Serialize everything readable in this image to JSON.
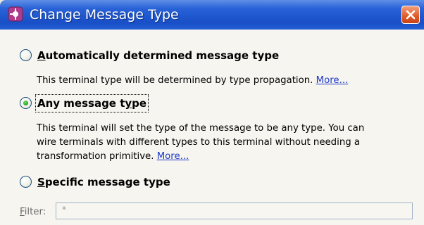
{
  "window": {
    "title": "Change Message Type",
    "icon": "plug-icon",
    "close_icon": "close-icon"
  },
  "options": [
    {
      "label_prefix": "",
      "label_mnemonic": "A",
      "label_suffix": "utomatically determined message type",
      "selected": false,
      "description": "This terminal type will be determined by type propagation. ",
      "more_link": "More..."
    },
    {
      "label_prefix": "Any message t",
      "label_mnemonic": "y",
      "label_suffix": "pe",
      "selected": true,
      "description_lines": [
        "This terminal will set the type of the message to be any type. You can",
        "wire terminals with different types to this terminal without needing a",
        "transformation primitive. "
      ],
      "more_link": "More..."
    },
    {
      "label_prefix": "",
      "label_mnemonic": "S",
      "label_suffix": "pecific message type",
      "selected": false
    }
  ],
  "filter": {
    "label_mnemonic": "F",
    "label_suffix": "ilter:",
    "value": "*"
  },
  "colors": {
    "titlebar": "#2a63d8",
    "link": "#1f3ac7",
    "radio_selected_dot": "#21a121"
  }
}
